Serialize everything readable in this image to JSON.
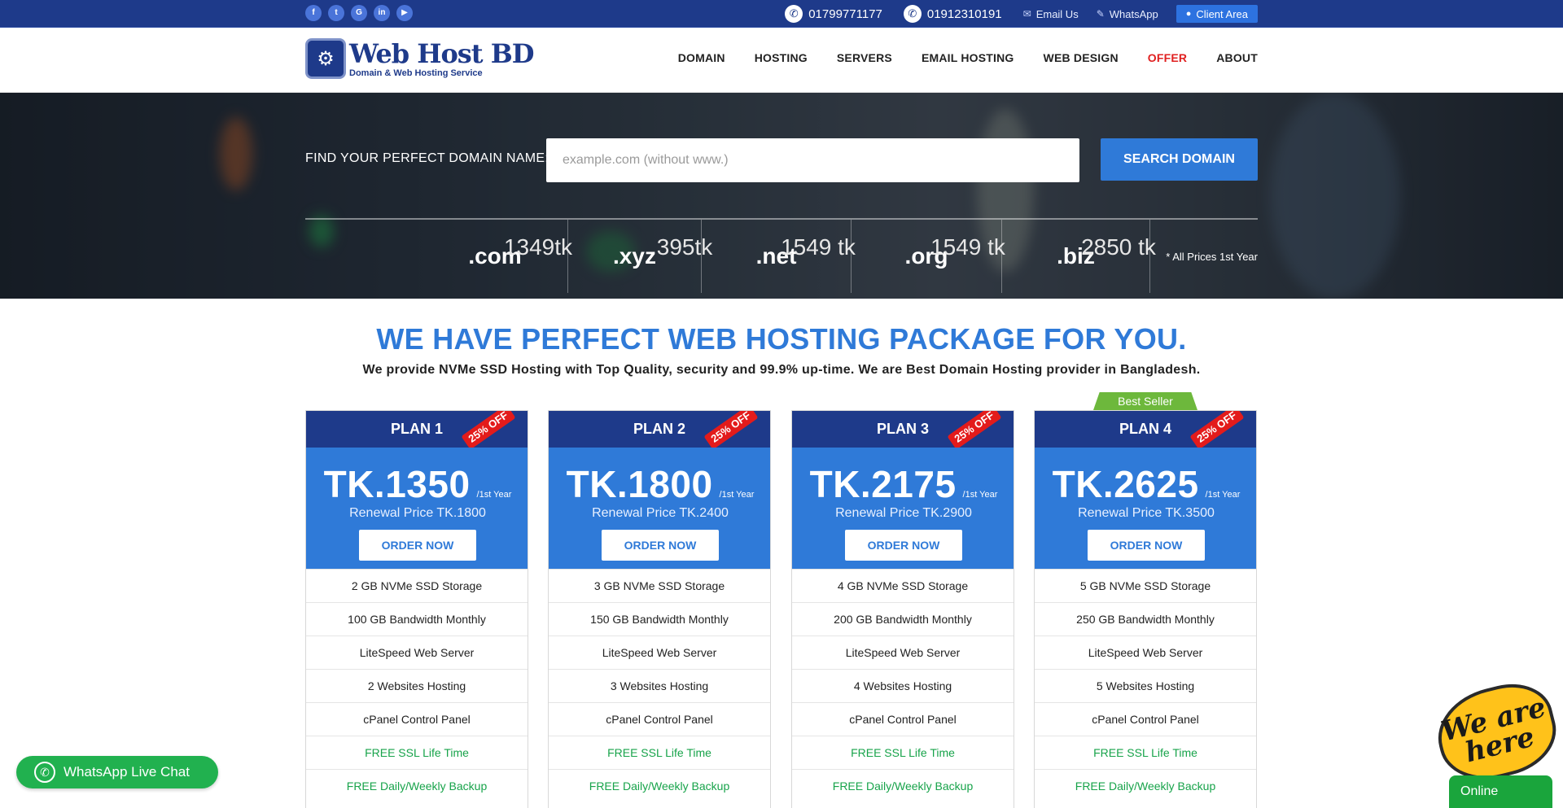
{
  "topbar": {
    "social": [
      {
        "name": "facebook-icon",
        "glyph": "f"
      },
      {
        "name": "twitter-icon",
        "glyph": "t"
      },
      {
        "name": "google-icon",
        "glyph": "G"
      },
      {
        "name": "linkedin-icon",
        "glyph": "in"
      },
      {
        "name": "youtube-icon",
        "glyph": "▶"
      }
    ],
    "phone1": "01799771177",
    "phone2": "01912310191",
    "email_label": "Email Us",
    "whatsapp_label": "WhatsApp",
    "client_area_label": "Client Area"
  },
  "header": {
    "logo_name": "Web Host BD",
    "logo_tagline": "Domain & Web Hosting Service",
    "nav": [
      "DOMAIN",
      "HOSTING",
      "SERVERS",
      "EMAIL HOSTING",
      "WEB DESIGN",
      "OFFER",
      "ABOUT"
    ],
    "offer_color": "#e02020"
  },
  "hero": {
    "search_label": "FIND YOUR PERFECT DOMAIN NAME:",
    "search_placeholder": "example.com (without www.)",
    "search_button": "SEARCH DOMAIN",
    "tlds": [
      {
        "ext": ".com",
        "price": "1349tk"
      },
      {
        "ext": ".xyz",
        "price": "395tk"
      },
      {
        "ext": ".net",
        "price": "1549 tk"
      },
      {
        "ext": ".org",
        "price": "1549 tk"
      },
      {
        "ext": ".biz",
        "price": "2850 tk"
      }
    ],
    "price_note": "* All Prices 1st Year"
  },
  "section": {
    "title": "WE HAVE PERFECT WEB HOSTING PACKAGE FOR YOU.",
    "subtitle": "We provide NVMe SSD Hosting with Top Quality, security and 99.9% up-time. We are Best Domain Hosting provider in Bangladesh."
  },
  "plans": [
    {
      "name": "PLAN 1",
      "ribbon": "25% OFF",
      "price": "TK.1350",
      "per": "/1st Year",
      "renewal": "Renewal Price TK.1800",
      "order": "ORDER NOW",
      "features": [
        "2 GB NVMe SSD Storage",
        "100 GB Bandwidth Monthly",
        "LiteSpeed Web Server",
        "2 Websites Hosting",
        "cPanel Control Panel",
        "FREE SSL Life Time",
        "FREE Daily/Weekly Backup"
      ]
    },
    {
      "name": "PLAN 2",
      "ribbon": "25% OFF",
      "price": "TK.1800",
      "per": "/1st Year",
      "renewal": "Renewal Price TK.2400",
      "order": "ORDER NOW",
      "features": [
        "3 GB NVMe SSD Storage",
        "150 GB Bandwidth Monthly",
        "LiteSpeed Web Server",
        "3 Websites Hosting",
        "cPanel Control Panel",
        "FREE SSL Life Time",
        "FREE Daily/Weekly Backup"
      ]
    },
    {
      "name": "PLAN 3",
      "ribbon": "25% OFF",
      "price": "TK.2175",
      "per": "/1st Year",
      "renewal": "Renewal Price TK.2900",
      "order": "ORDER NOW",
      "features": [
        "4 GB NVMe SSD Storage",
        "200 GB Bandwidth Monthly",
        "LiteSpeed Web Server",
        "4 Websites Hosting",
        "cPanel Control Panel",
        "FREE SSL Life Time",
        "FREE Daily/Weekly Backup"
      ]
    },
    {
      "name": "PLAN 4",
      "ribbon": "25% OFF",
      "price": "TK.2625",
      "per": "/1st Year",
      "renewal": "Renewal Price TK.3500",
      "order": "ORDER NOW",
      "badge": "Best Seller",
      "features": [
        "5 GB NVMe SSD Storage",
        "250 GB Bandwidth Monthly",
        "LiteSpeed Web Server",
        "5 Websites Hosting",
        "cPanel Control Panel",
        "FREE SSL Life Time",
        "FREE Daily/Weekly Backup"
      ]
    }
  ],
  "widgets": {
    "whatsapp_chat": "WhatsApp Live Chat",
    "we_are": "We are",
    "here": "here",
    "online": "Online"
  },
  "colors": {
    "navy": "#1e3a8a",
    "accent_blue": "#2f7ad8",
    "free_green": "#17a34a",
    "whatsapp_green": "#21b14f"
  }
}
